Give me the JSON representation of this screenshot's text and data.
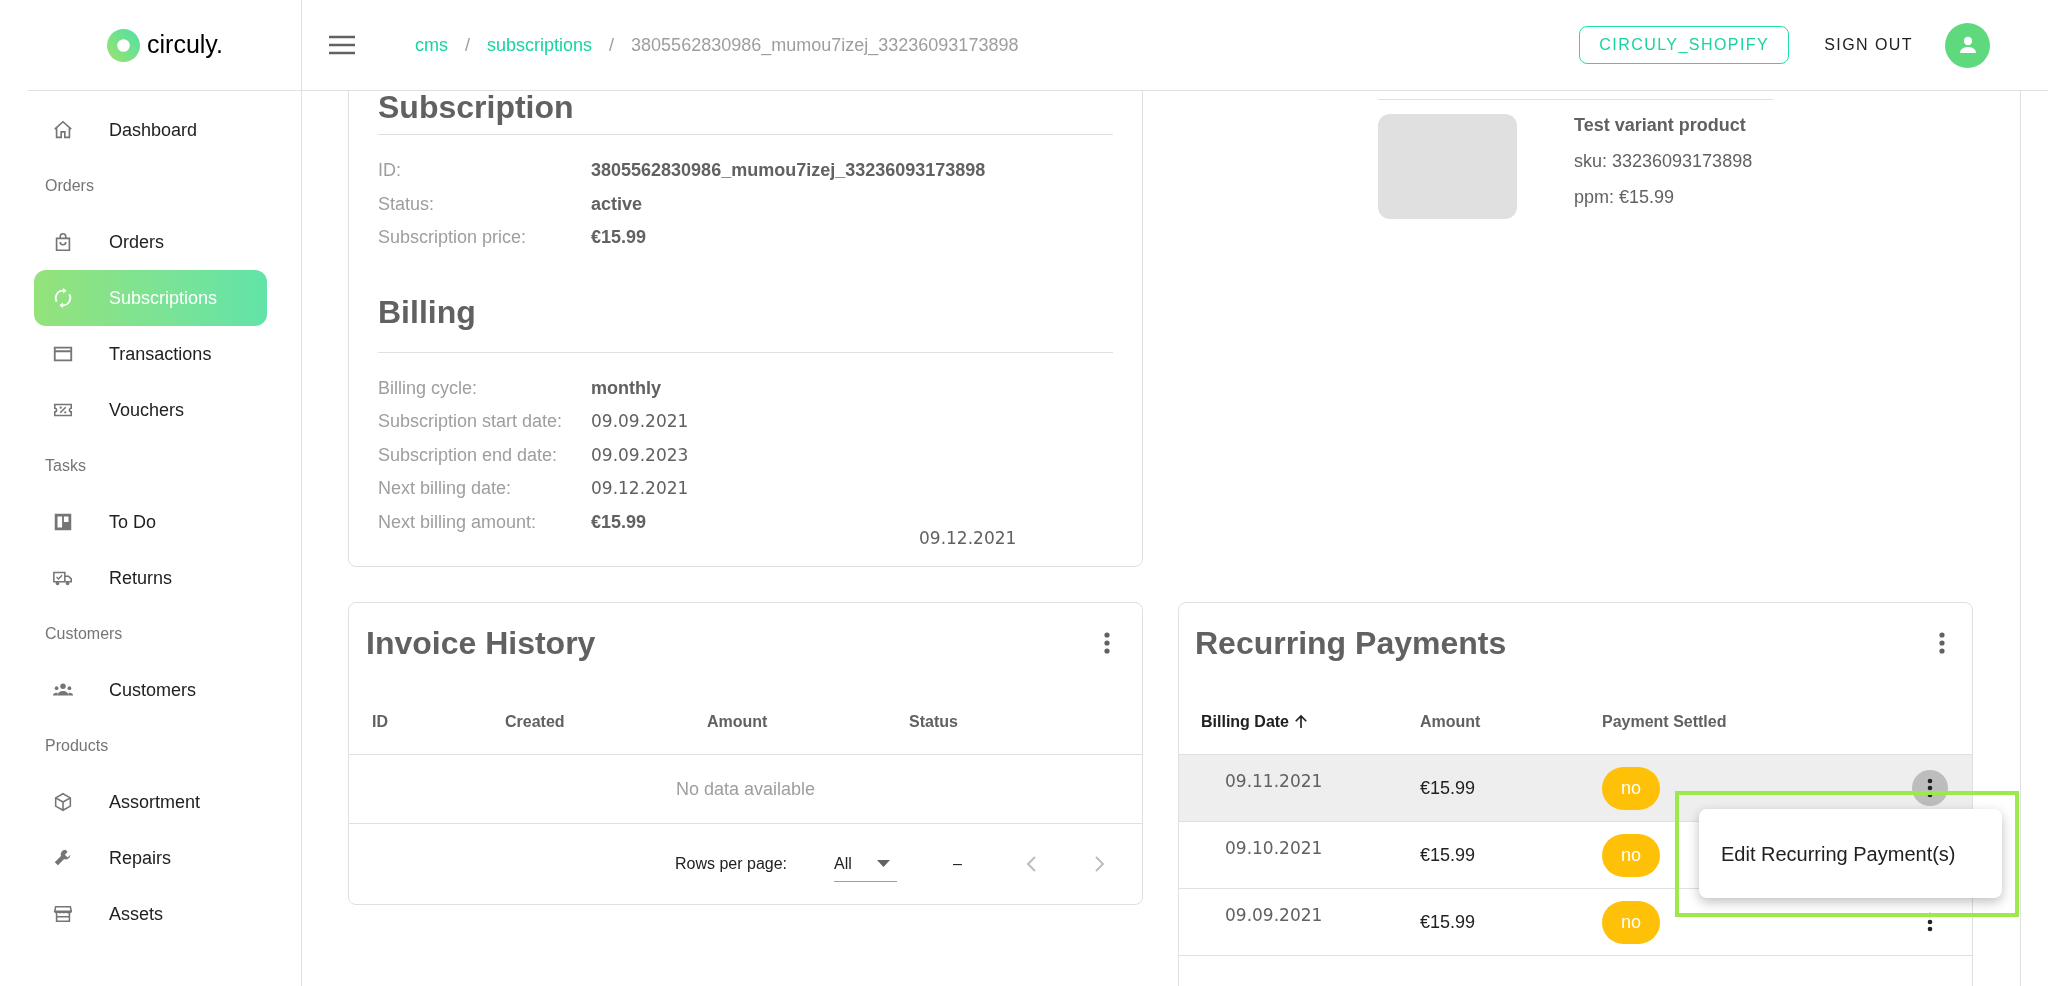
{
  "sidebar": {
    "logo": "circuly.",
    "items": [
      {
        "kind": "link",
        "label": "Dashboard",
        "selected": false
      },
      {
        "kind": "section",
        "label": "Orders"
      },
      {
        "kind": "link",
        "label": "Orders",
        "selected": false
      },
      {
        "kind": "link",
        "label": "Subscriptions",
        "selected": true
      },
      {
        "kind": "link",
        "label": "Transactions",
        "selected": false
      },
      {
        "kind": "link",
        "label": "Vouchers",
        "selected": false
      },
      {
        "kind": "section",
        "label": "Tasks"
      },
      {
        "kind": "link",
        "label": "To Do",
        "selected": false
      },
      {
        "kind": "link",
        "label": "Returns",
        "selected": false
      },
      {
        "kind": "section",
        "label": "Customers"
      },
      {
        "kind": "link",
        "label": "Customers",
        "selected": false
      },
      {
        "kind": "section",
        "label": "Products"
      },
      {
        "kind": "link",
        "label": "Assortment",
        "selected": false
      },
      {
        "kind": "link",
        "label": "Repairs",
        "selected": false
      },
      {
        "kind": "link",
        "label": "Assets",
        "selected": false
      }
    ]
  },
  "header": {
    "breadcrumbs": [
      {
        "kind": "link",
        "label": "cms"
      },
      {
        "kind": "separator",
        "label": "/"
      },
      {
        "kind": "link",
        "label": "subscriptions"
      },
      {
        "kind": "separator",
        "label": "/"
      },
      {
        "kind": "current",
        "label": "3805562830986_mumou7izej_33236093173898"
      }
    ],
    "shop_button": "CIRCULY_SHOPIFY",
    "sign_out": "SIGN OUT"
  },
  "subscription": {
    "title": "Subscription",
    "fields": [
      {
        "kind": "bold",
        "label": "ID:",
        "value": "3805562830986_mumou7izej_33236093173898"
      },
      {
        "kind": "bold",
        "label": "Status:",
        "value": "active"
      },
      {
        "kind": "bold",
        "label": "Subscription price:",
        "value": "€15.99"
      }
    ]
  },
  "billing": {
    "title": "Billing",
    "fields": [
      {
        "kind": "bold",
        "label": "Billing cycle:",
        "value": "monthly"
      },
      {
        "kind": "date",
        "label": "Subscription start date:",
        "value": "09.09.2021"
      },
      {
        "kind": "date",
        "label": "Subscription end date:",
        "value": "09.09.2023"
      },
      {
        "kind": "date",
        "label": "Next billing date:",
        "value": "09.12.2021"
      },
      {
        "kind": "bold",
        "label": "Next billing amount:",
        "value": "€15.99"
      }
    ],
    "note": "09.12.2021"
  },
  "product": {
    "name": "Test variant product",
    "sku": "sku: 33236093173898",
    "ppm": "ppm: €15.99"
  },
  "invoice_history": {
    "title": "Invoice History",
    "columns": [
      "ID",
      "Created",
      "Amount",
      "Status"
    ],
    "empty_text": "No data available",
    "rows_per_page_label": "Rows per page:",
    "rows_per_page": "All",
    "range": "–"
  },
  "recurring_payments": {
    "title": "Recurring Payments",
    "columns": [
      {
        "label": "Billing Date",
        "sorted": true
      },
      {
        "label": "Amount",
        "sorted": false
      },
      {
        "label": "Payment Settled",
        "sorted": false
      }
    ],
    "rows": [
      {
        "billing_date": "09.11.2021",
        "amount": "€15.99",
        "settled": "no",
        "highlighted": true
      },
      {
        "billing_date": "09.10.2021",
        "amount": "€15.99",
        "settled": "no",
        "highlighted": false
      },
      {
        "billing_date": "09.09.2021",
        "amount": "€15.99",
        "settled": "no",
        "highlighted": false
      }
    ],
    "menu": {
      "items": [
        "Edit Recurring Payment(s)"
      ],
      "highlighted": true
    }
  }
}
